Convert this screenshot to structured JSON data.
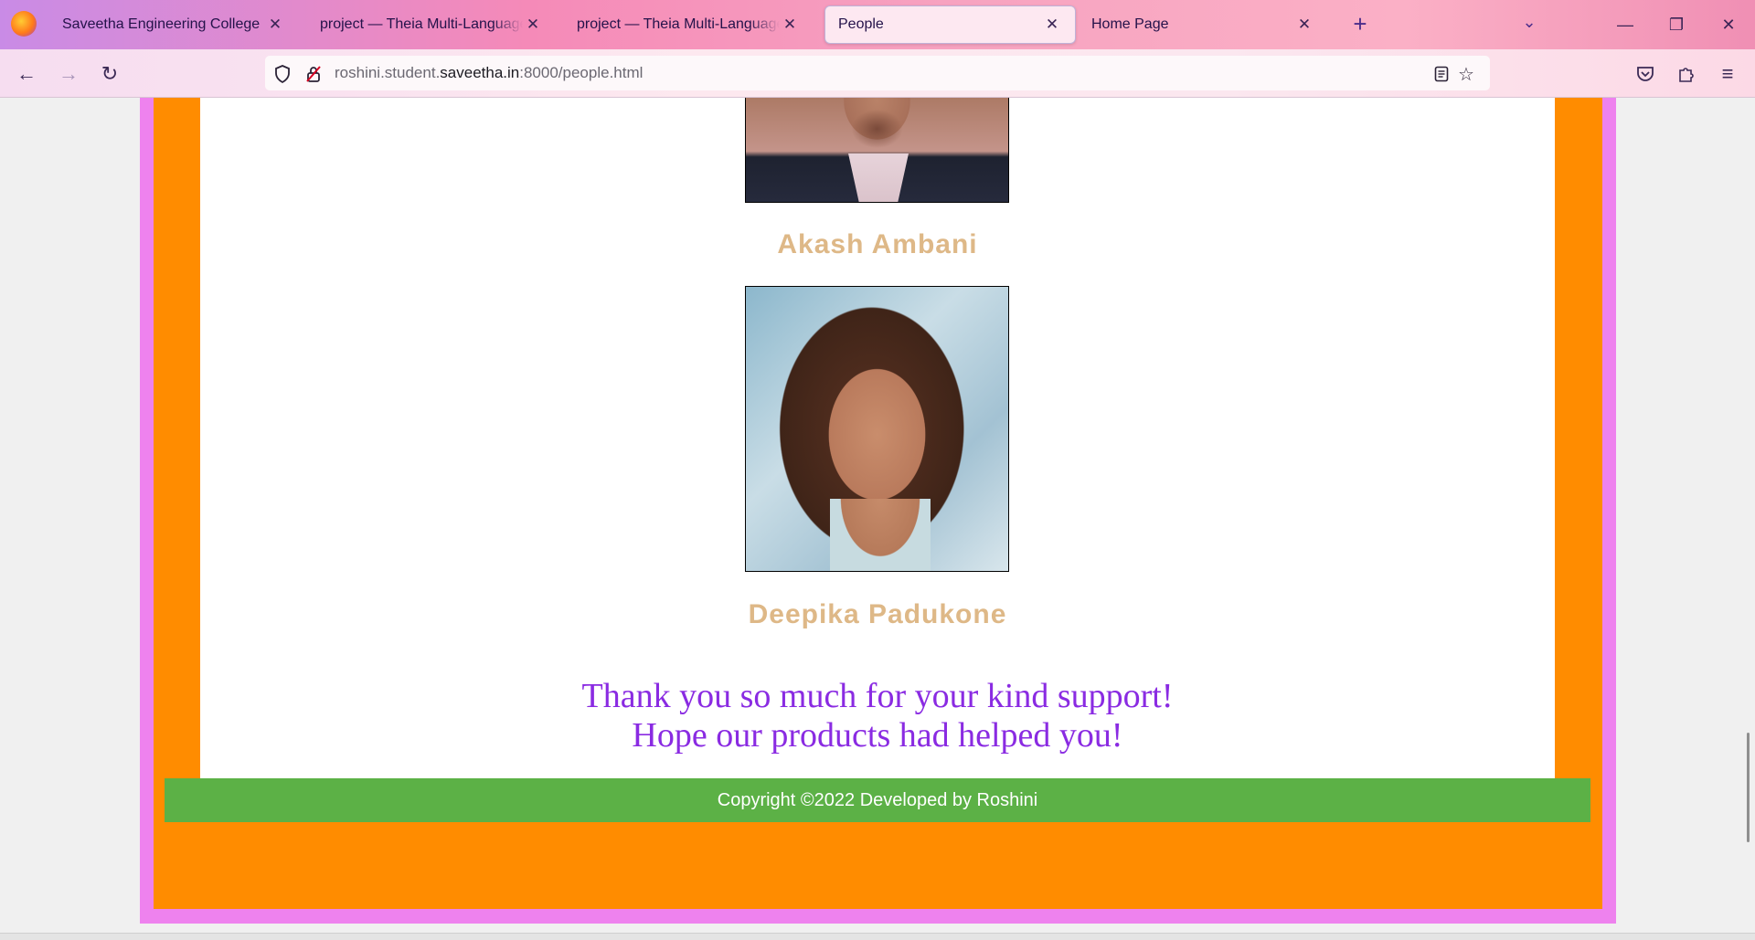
{
  "browser": {
    "tabs": [
      {
        "title": "Saveetha Engineering College",
        "active": false
      },
      {
        "title": "project — Theia Multi-Language Exp",
        "active": false
      },
      {
        "title": "project — Theia Multi-Language Exp",
        "active": false
      },
      {
        "title": "People",
        "active": true
      },
      {
        "title": "Home Page",
        "active": false
      }
    ],
    "url_prefix": "roshini.student.",
    "url_domain": "saveetha.in",
    "url_suffix": ":8000/people.html"
  },
  "page": {
    "people": [
      {
        "name": "Akash Ambani"
      },
      {
        "name": "Deepika Padukone"
      }
    ],
    "thanks_line1": "Thank you so much for your kind support!",
    "thanks_line2": "Hope our products had helped you!",
    "footer": "Copyright ©2022 Developed by Roshini"
  },
  "colors": {
    "page_border": "#ee82ee",
    "page_frame": "#ff8c00",
    "name_color": "#deb887",
    "thanks_color": "#8a2be2",
    "footer_bg": "#5cb146"
  }
}
